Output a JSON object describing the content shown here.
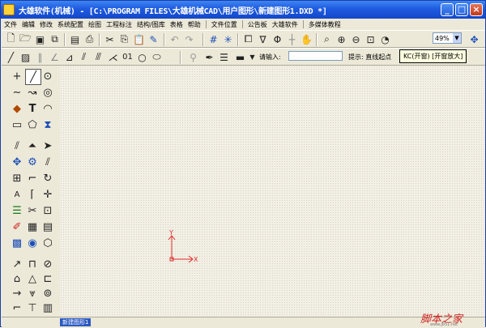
{
  "window": {
    "title": "大雄软件(机械) - [C:\\PROGRAM FILES\\大雄机械CAD\\用户图形\\新建图形1.DXD *]",
    "controls": {
      "minimize": "_",
      "maximize": "□",
      "close": "×"
    }
  },
  "menu": {
    "items": [
      "文件",
      "编辑",
      "修改",
      "系统配置",
      "绘图",
      "工程标注",
      "结构/图库",
      "表格",
      "帮助",
      "文件位置",
      "公告板",
      "大雄软件",
      "多媒体教程"
    ]
  },
  "toolbar2": {
    "input_label": "请输入:",
    "input_value": "",
    "hint": "提示: 直线起点",
    "zoom_value": "49%"
  },
  "tooltip": "KC(开窗) [开窗放大]",
  "status": {
    "tab_label": "新建图形1"
  },
  "watermark": {
    "text": "脚本之家",
    "url": "www.jb51.net"
  },
  "icons": {
    "toolbar1": [
      "new-file-icon",
      "open-folder-icon",
      "save-icon",
      "save-all-icon",
      "preview-icon",
      "print-icon",
      "cut-icon",
      "copy-icon",
      "paste-icon",
      "clean-icon",
      "undo-icon",
      "redo-icon",
      "grid-icon",
      "snap-icon",
      "layer-icon",
      "filter-icon",
      "diameter-icon",
      "crosshair-icon",
      "pan-icon",
      "zoom-icon",
      "zoom-window-icon",
      "zoom-out-icon",
      "fit-icon",
      "aerial-icon",
      "nav-icon"
    ],
    "toolbar2": [
      "line-icon",
      "hatch-icon",
      "parallel-icon",
      "angle-icon",
      "multiline-icon",
      "polyline-icon",
      "text-01-icon",
      "circle-icon",
      "ellipse-icon",
      "weld-icon",
      "pen-icon",
      "linestyle-icon",
      "lineweight-icon"
    ],
    "palette": [
      "point-icon",
      "line-icon",
      "circle-icon",
      "spline-icon",
      "curve-icon",
      "donut-icon",
      "fill-icon",
      "text-icon",
      "arc-icon",
      "rectangle-icon",
      "pentagon-icon",
      "symbol-icon",
      "mirror-icon",
      "triangle-icon",
      "select-icon",
      "array-icon",
      "gear-icon",
      "pipe-icon",
      "block-icon",
      "fillet-icon",
      "rotate-icon",
      "scale-icon",
      "chamfer-icon",
      "move-icon",
      "list-icon",
      "trim-icon",
      "insert-icon",
      "erase-icon",
      "grid-icon",
      "table-icon",
      "image-icon",
      "globe-icon",
      "box-icon",
      "dimension-icon",
      "bracket-icon",
      "offset-icon",
      "hole-icon",
      "angle-icon",
      "measure-icon",
      "arrow-icon",
      "weld-icon",
      "tolerance-icon",
      "axis-icon",
      "flag-icon",
      "table-icon"
    ]
  },
  "axis": {
    "x": "X",
    "y": "Y"
  },
  "colors": {
    "title_bar": "#1f5ae0",
    "canvas": "#f2efe4",
    "axis": "#e22b2b",
    "watermark": "#d21f1f"
  }
}
